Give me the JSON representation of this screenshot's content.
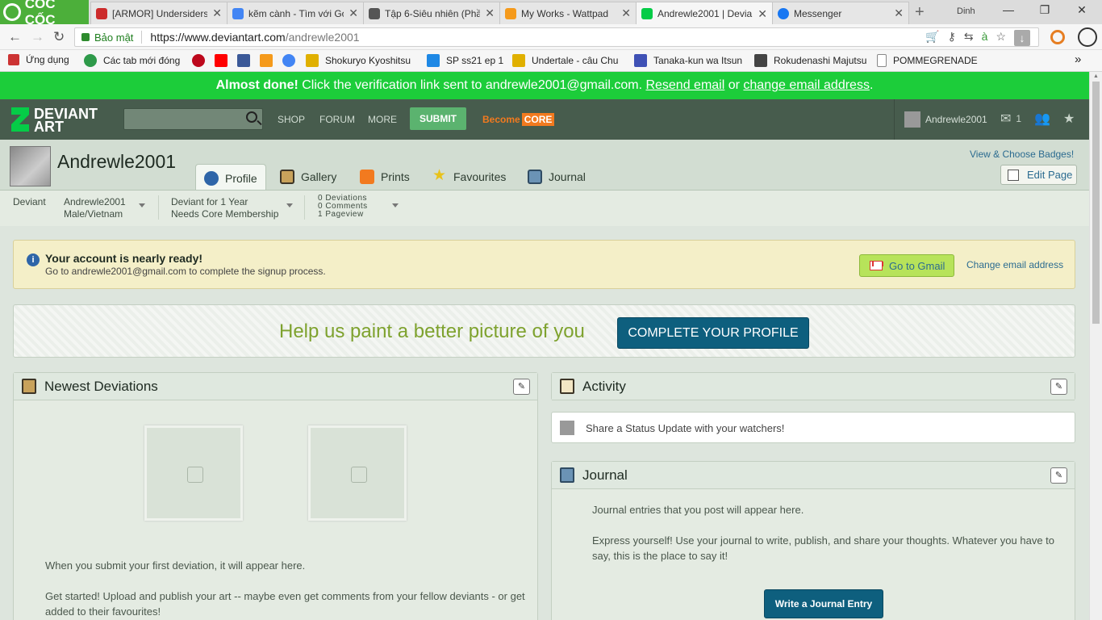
{
  "browser": {
    "brand": "CỐC CỐC",
    "tabs": [
      {
        "title": "[ARMOR] Undersiders",
        "color": "#cc2b2b"
      },
      {
        "title": "kẽm cành - Tìm với Go",
        "color": "#4285f4"
      },
      {
        "title": "Tập 6-Siêu nhiên (Phầ",
        "color": "#555555"
      },
      {
        "title": "My Works - Wattpad",
        "color": "#f59a1b"
      },
      {
        "title": "Andrewle2001 | Devian",
        "color": "#05cc47"
      },
      {
        "title": "Messenger",
        "color": "#1877f2"
      }
    ],
    "window_user": "Dinh",
    "secure_label": "Bảo mật",
    "url_base": "https://www.deviantart.com",
    "url_path": "/andrewle2001",
    "bookmarks": [
      {
        "label": "Ứng dụng",
        "color": "#cc3333"
      },
      {
        "label": "Các tab mới đóng",
        "color": "#2e9a4a"
      },
      {
        "label": "",
        "color": "#bd081c"
      },
      {
        "label": "",
        "color": "#ff0000"
      },
      {
        "label": "",
        "color": "#3b5998"
      },
      {
        "label": "",
        "color": "#f59a1b"
      },
      {
        "label": "",
        "color": "#4285f4"
      },
      {
        "label": "Shokuryo Kyoshitsu",
        "color": "#e0b000"
      },
      {
        "label": "SP ss21 ep 1",
        "color": "#1e88e5"
      },
      {
        "label": "Undertale - câu Chu",
        "color": "#e0b000"
      },
      {
        "label": "Tanaka-kun wa Itsun",
        "color": "#3f51b5"
      },
      {
        "label": "Rokudenashi Majutsu",
        "color": "#444444"
      },
      {
        "label": "POMMEGRENADE",
        "color": "#888888"
      }
    ]
  },
  "verify": {
    "bold": "Almost done!",
    "text": " Click the verification link sent to andrewle2001@gmail.com. ",
    "resend": "Resend email",
    "or": " or ",
    "change": "change email address",
    "end": "."
  },
  "header": {
    "logo_top": "DEVIANT",
    "logo_bottom": "ART",
    "nav": [
      "SHOP",
      "FORUM",
      "MORE"
    ],
    "submit": "SUBMIT",
    "become": "Become",
    "core": "CORE",
    "username": "Andrewle2001",
    "message_count": "1"
  },
  "profile": {
    "username": "Andrewle2001",
    "tabs": [
      "Profile",
      "Gallery",
      "Prints",
      "Favourites",
      "Journal"
    ],
    "badges": "View & Choose Badges!",
    "edit_page": "Edit Page",
    "rank": "Deviant",
    "name": "Andrewle2001",
    "location": "Male/Vietnam",
    "member_for": "Deviant for 1 Year",
    "membership": "Needs Core Membership",
    "stats": [
      "0 Deviations",
      "0 Comments",
      "1 Pageview"
    ]
  },
  "notice": {
    "title": "Your account is nearly ready!",
    "subtitle": "Go to andrewle2001@gmail.com to complete the signup process.",
    "gmail_button": "Go to Gmail",
    "change_email": "Change email address"
  },
  "paint": {
    "text": "Help us paint a better picture of you",
    "button": "COMPLETE YOUR PROFILE"
  },
  "newest": {
    "title": "Newest Deviations",
    "line1": "When you submit your first deviation, it will appear here.",
    "line2": "Get started! Upload and publish your art -- maybe even get comments from your fellow deviants - or get added to their favourites!"
  },
  "activity": {
    "title": "Activity",
    "status_placeholder": "Share a Status Update with your watchers!"
  },
  "journal": {
    "title": "Journal",
    "line1": "Journal entries that you post will appear here.",
    "line2": "Express yourself! Use your journal to write, publish, and share your thoughts. Whatever you have to say, this is the place to say it!",
    "button": "Write a Journal Entry"
  }
}
